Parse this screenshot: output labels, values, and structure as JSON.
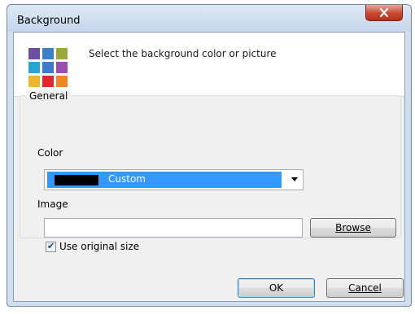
{
  "window": {
    "title": "Background",
    "close_icon": "close-icon"
  },
  "header": {
    "icon": "color-palette-icon",
    "palette_colors": [
      "#6a4fa3",
      "#3f7fc5",
      "#9aa83a",
      "#2aa4d8",
      "#3f78d0",
      "#9b4fb0",
      "#f0b52b",
      "#e0262f",
      "#f08524"
    ],
    "description": "Select the background color or picture"
  },
  "general": {
    "group_label": "General",
    "color_label": "Color",
    "color_value": "Custom",
    "color_swatch": "#000000",
    "image_label": "Image",
    "image_value": "",
    "browse_label": "Browse",
    "use_original_size_label": "Use original size",
    "use_original_size_checked": true
  },
  "buttons": {
    "ok_label": "OK",
    "cancel_label": "Cancel"
  }
}
